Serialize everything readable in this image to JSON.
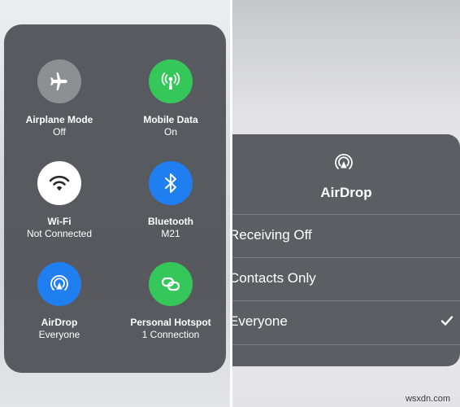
{
  "control_center": {
    "tiles": [
      {
        "title": "Airplane Mode",
        "sub": "Off",
        "icon": "airplane-icon",
        "color": "#8e8f93"
      },
      {
        "title": "Mobile Data",
        "sub": "On",
        "icon": "antenna-icon",
        "color": "#35c759"
      },
      {
        "title": "Wi-Fi",
        "sub": "Not Connected",
        "icon": "wifi-icon",
        "color": "#ffffff"
      },
      {
        "title": "Bluetooth",
        "sub": "M21",
        "icon": "bluetooth-icon",
        "color": "#1f7ef0"
      },
      {
        "title": "AirDrop",
        "sub": "Everyone",
        "icon": "airdrop-icon",
        "color": "#1f7ef0"
      },
      {
        "title": "Personal Hotspot",
        "sub": "1 Connection",
        "icon": "hotspot-icon",
        "color": "#35c759"
      }
    ]
  },
  "airdrop_menu": {
    "title": "AirDrop",
    "icon": "airdrop-icon",
    "options": [
      {
        "label": "Receiving Off",
        "selected": false
      },
      {
        "label": "Contacts Only",
        "selected": false
      },
      {
        "label": "Everyone",
        "selected": true
      }
    ]
  },
  "watermark": "wsxdn.com"
}
